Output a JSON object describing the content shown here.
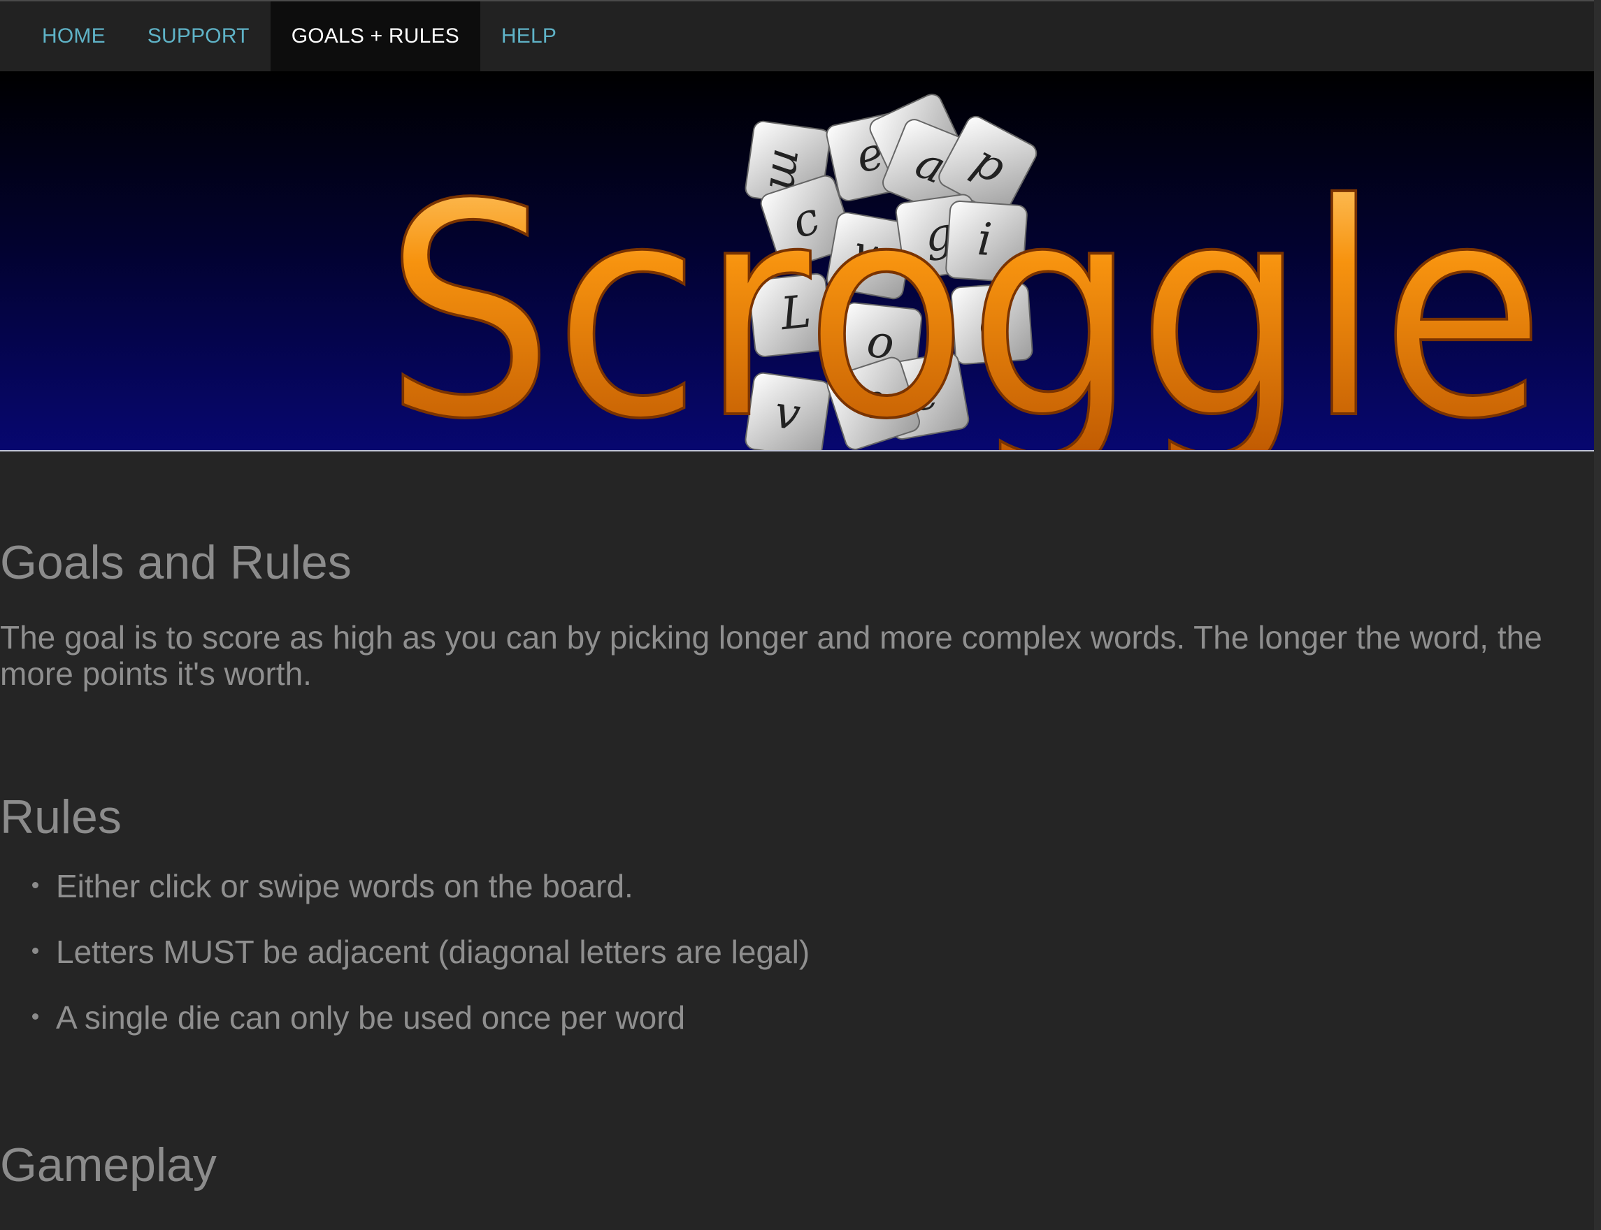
{
  "nav": {
    "items": [
      {
        "label": "HOME",
        "active": false
      },
      {
        "label": "SUPPORT",
        "active": false
      },
      {
        "label": "GOALS + RULES",
        "active": true
      },
      {
        "label": "HELP",
        "active": false
      }
    ]
  },
  "banner": {
    "logo_text": "Scroggle",
    "dice_letters": [
      "m",
      "e",
      "s",
      "a",
      "p",
      "c",
      "w",
      "h",
      "g",
      "i",
      "L",
      "o",
      "e",
      "e",
      "v",
      "e"
    ],
    "colors": {
      "logo": "#f58a07",
      "background_top": "#000000",
      "background_bottom": "#070770"
    }
  },
  "main": {
    "goals_heading": "Goals and Rules",
    "goals_text": "The goal is to score as high as you can by picking longer and more complex words. The longer the word, the more points it's worth.",
    "rules_heading": "Rules",
    "rules": [
      "Either click or swipe words on the board.",
      "Letters MUST be adjacent (diagonal letters are legal)",
      "A single die can only be used once per word"
    ],
    "gameplay_heading": "Gameplay"
  }
}
